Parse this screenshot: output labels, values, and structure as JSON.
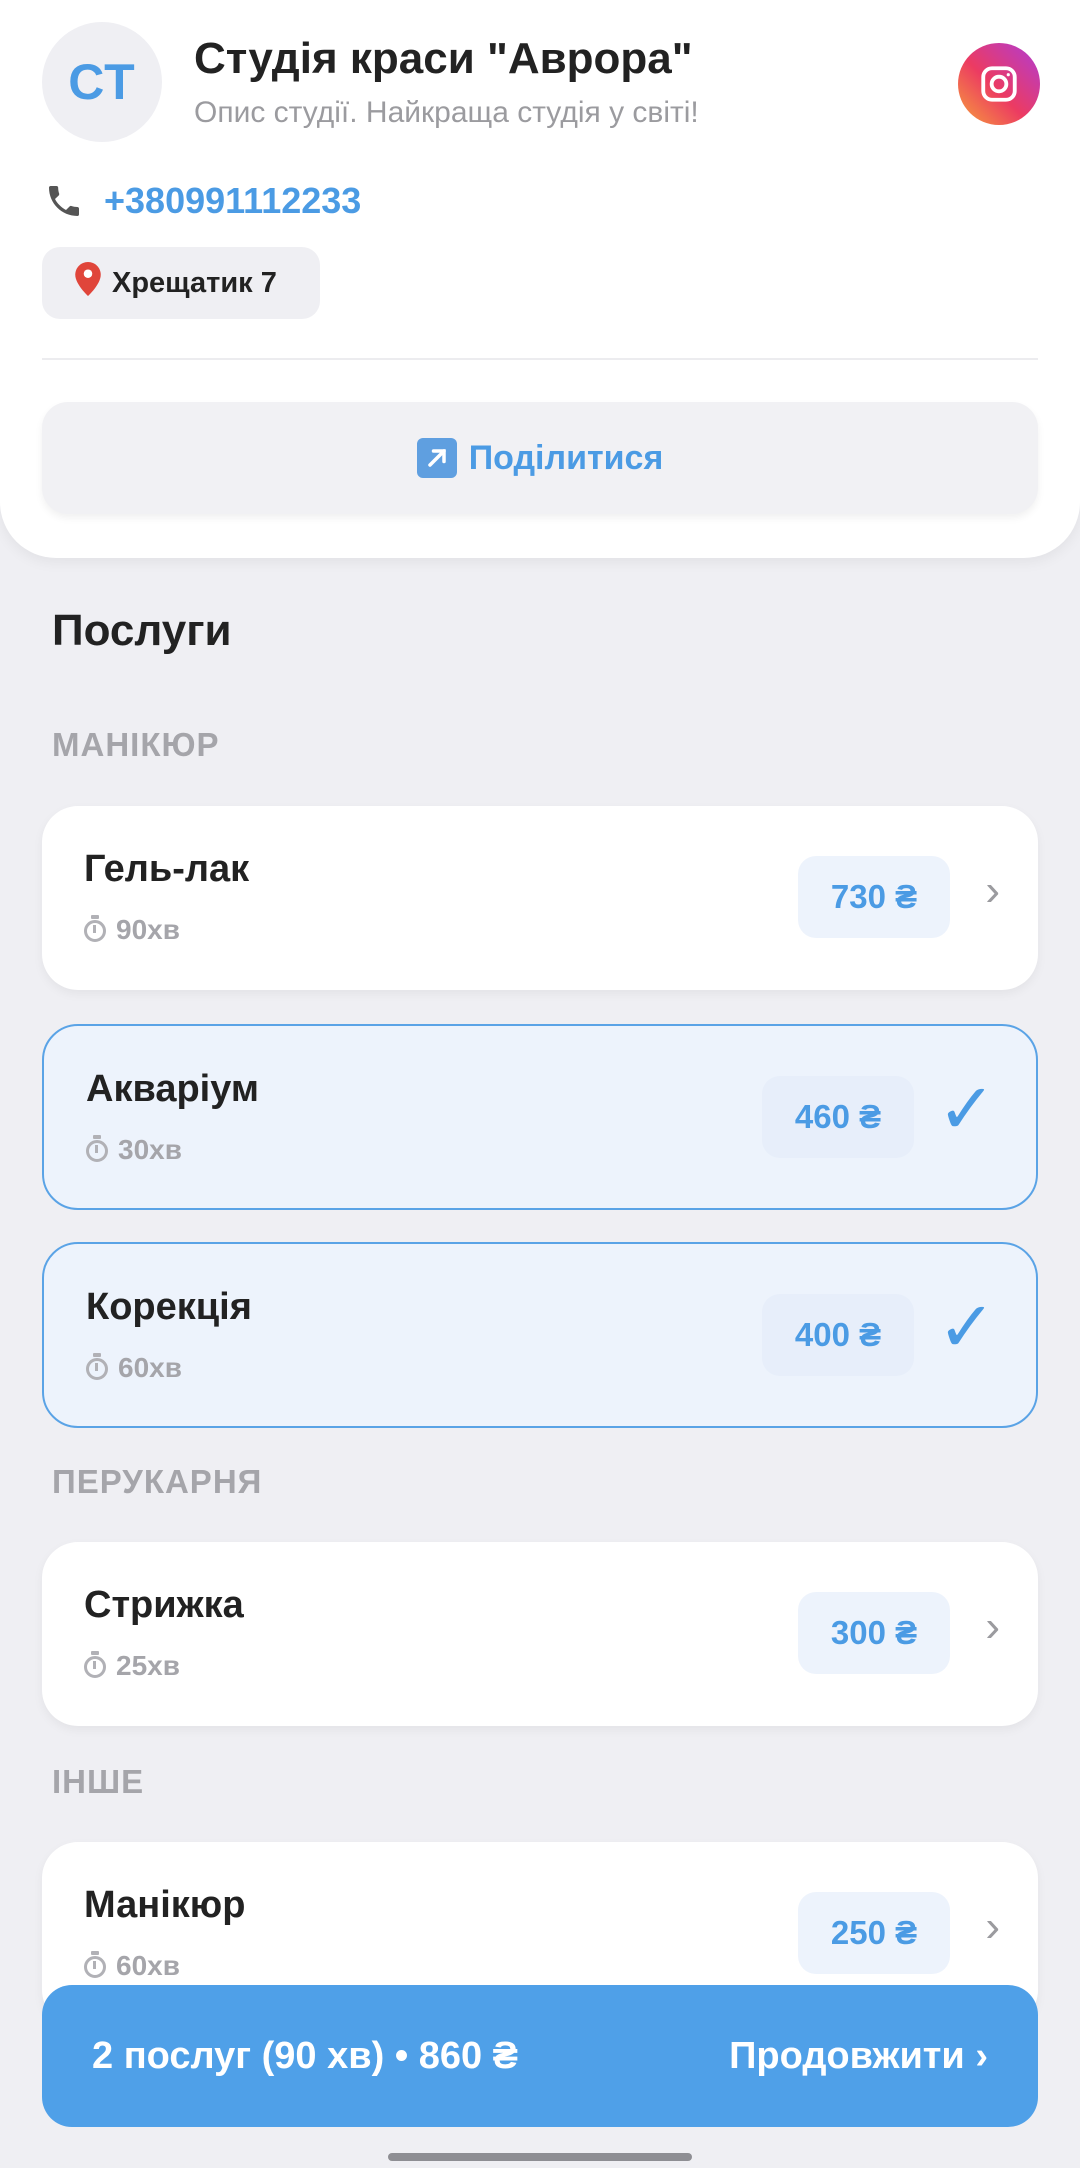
{
  "studio": {
    "initials": "СТ",
    "name": "Студія краси \"Аврора\"",
    "description": "Опис студії. Найкраща студія у світі!",
    "phone": "+380991112233",
    "address": "Хрещатик 7",
    "share_label": "Поділитися"
  },
  "icons": {
    "instagram": "instagram-icon",
    "phone": "phone-icon",
    "pin": "pin-icon",
    "share": "share-arrow-icon",
    "timer": "timer-icon",
    "chevron": "chevron-right-icon",
    "check": "checkmark-icon"
  },
  "services_title": "Послуги",
  "categories": [
    {
      "title": "МАНІКЮР",
      "services": [
        {
          "name": "Гель-лак",
          "duration": "90хв",
          "price": "730 ₴",
          "selected": false
        },
        {
          "name": "Акваріум",
          "duration": "30хв",
          "price": "460 ₴",
          "selected": true
        },
        {
          "name": "Корекція",
          "duration": "60хв",
          "price": "400 ₴",
          "selected": true
        }
      ]
    },
    {
      "title": "ПЕРУКАРНЯ",
      "services": [
        {
          "name": "Стрижка",
          "duration": "25хв",
          "price": "300 ₴",
          "selected": false
        }
      ]
    },
    {
      "title": "ІНШЕ",
      "services": [
        {
          "name": "Манікюр",
          "duration": "60хв",
          "price": "250 ₴",
          "selected": false
        }
      ]
    }
  ],
  "bottom_bar": {
    "summary": "2 послуг (90 хв) • 860 ₴",
    "continue_label": "Продовжити ›"
  },
  "colors": {
    "accent": "#4b9be4",
    "background": "#efeff3",
    "card": "#ffffff",
    "selected_card": "#edf3fc"
  }
}
